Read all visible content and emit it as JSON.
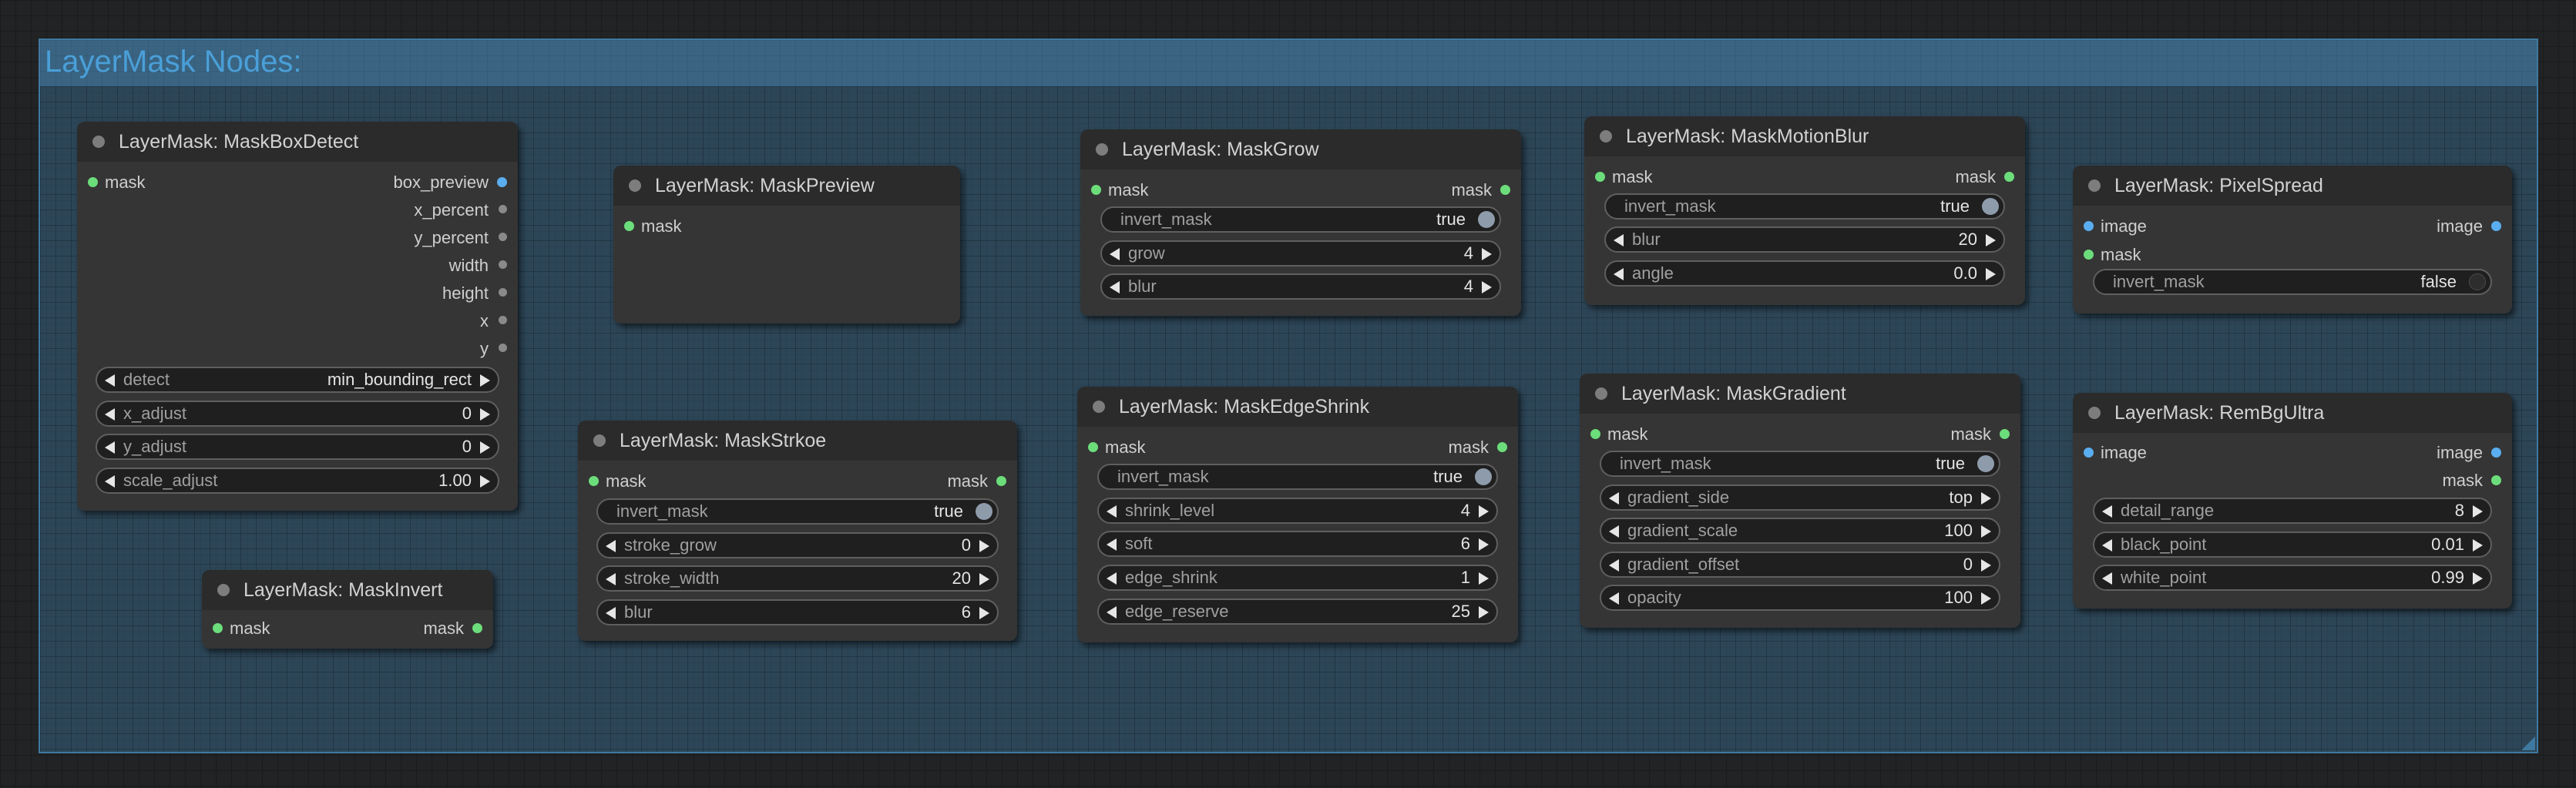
{
  "group": {
    "title": "LayerMask Nodes:"
  },
  "nodes": {
    "maskboxdetect": {
      "title": "LayerMask: MaskBoxDetect",
      "inputs": [
        "mask"
      ],
      "outputs": [
        "box_preview",
        "x_percent",
        "y_percent",
        "width",
        "height",
        "x",
        "y"
      ],
      "widgets": [
        {
          "name": "detect",
          "value": "min_bounding_rect"
        },
        {
          "name": "x_adjust",
          "value": "0"
        },
        {
          "name": "y_adjust",
          "value": "0"
        },
        {
          "name": "scale_adjust",
          "value": "1.00"
        }
      ]
    },
    "maskpreview": {
      "title": "LayerMask: MaskPreview",
      "inputs": [
        "mask"
      ]
    },
    "maskinvert": {
      "title": "LayerMask: MaskInvert",
      "inputs": [
        "mask"
      ],
      "outputs": [
        "mask"
      ]
    },
    "maskstrkoe": {
      "title": "LayerMask: MaskStrkoe",
      "inputs": [
        "mask"
      ],
      "outputs": [
        "mask"
      ],
      "toggle": {
        "name": "invert_mask",
        "value": "true"
      },
      "widgets": [
        {
          "name": "stroke_grow",
          "value": "0"
        },
        {
          "name": "stroke_width",
          "value": "20"
        },
        {
          "name": "blur",
          "value": "6"
        }
      ]
    },
    "maskgrow": {
      "title": "LayerMask: MaskGrow",
      "inputs": [
        "mask"
      ],
      "outputs": [
        "mask"
      ],
      "toggle": {
        "name": "invert_mask",
        "value": "true"
      },
      "widgets": [
        {
          "name": "grow",
          "value": "4"
        },
        {
          "name": "blur",
          "value": "4"
        }
      ]
    },
    "maskedgeshrink": {
      "title": "LayerMask: MaskEdgeShrink",
      "inputs": [
        "mask"
      ],
      "outputs": [
        "mask"
      ],
      "toggle": {
        "name": "invert_mask",
        "value": "true"
      },
      "widgets": [
        {
          "name": "shrink_level",
          "value": "4"
        },
        {
          "name": "soft",
          "value": "6"
        },
        {
          "name": "edge_shrink",
          "value": "1"
        },
        {
          "name": "edge_reserve",
          "value": "25"
        }
      ]
    },
    "maskmotionblur": {
      "title": "LayerMask: MaskMotionBlur",
      "inputs": [
        "mask"
      ],
      "outputs": [
        "mask"
      ],
      "toggle": {
        "name": "invert_mask",
        "value": "true"
      },
      "widgets": [
        {
          "name": "blur",
          "value": "20"
        },
        {
          "name": "angle",
          "value": "0.0"
        }
      ]
    },
    "maskgradient": {
      "title": "LayerMask: MaskGradient",
      "inputs": [
        "mask"
      ],
      "outputs": [
        "mask"
      ],
      "toggle": {
        "name": "invert_mask",
        "value": "true"
      },
      "widgets": [
        {
          "name": "gradient_side",
          "value": "top"
        },
        {
          "name": "gradient_scale",
          "value": "100"
        },
        {
          "name": "gradient_offset",
          "value": "0"
        },
        {
          "name": "opacity",
          "value": "100"
        }
      ]
    },
    "pixelspread": {
      "title": "LayerMask: PixelSpread",
      "inputs": [
        "image",
        "mask"
      ],
      "outputs": [
        "image"
      ],
      "toggle": {
        "name": "invert_mask",
        "value": "false"
      }
    },
    "rembgultra": {
      "title": "LayerMask: RemBgUltra",
      "inputs": [
        "image"
      ],
      "outputs": [
        "image",
        "mask"
      ],
      "widgets": [
        {
          "name": "detail_range",
          "value": "8"
        },
        {
          "name": "black_point",
          "value": "0.01"
        },
        {
          "name": "white_point",
          "value": "0.99"
        }
      ]
    }
  },
  "colors": {
    "mask_slot": "#6cdd7b",
    "image_slot": "#5aaef0",
    "group_border": "#3f78a0",
    "group_title": "#4a9fd8"
  },
  "icons": {
    "slider_left": "triangle-left",
    "slider_right": "triangle-right",
    "toggle": "toggle-knob"
  }
}
